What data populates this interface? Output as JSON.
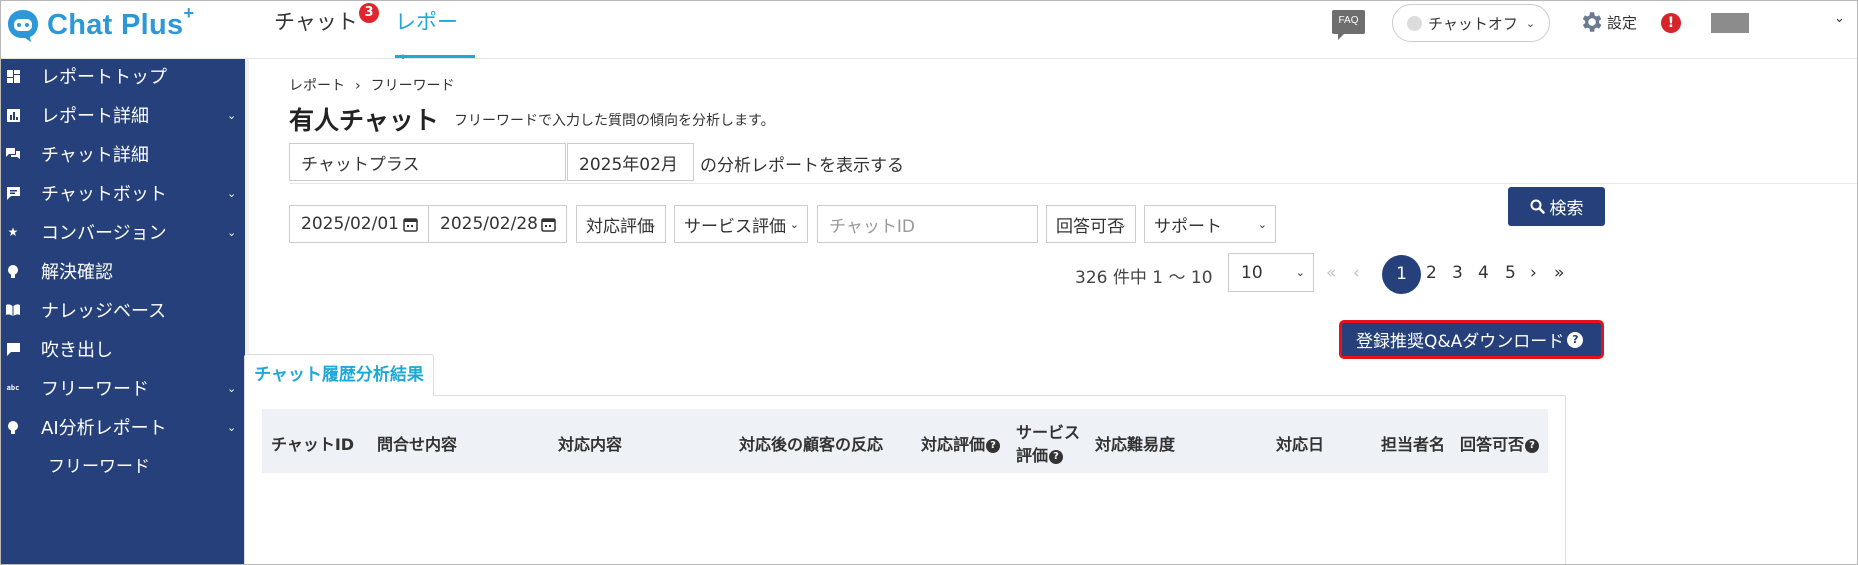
{
  "header": {
    "logo_text": "Chat Plus",
    "logo_plus": "+",
    "tabs": [
      {
        "label": "チャット",
        "badge": "3"
      },
      {
        "label": "レポート"
      }
    ],
    "faq_label": "FAQ",
    "status_label": "チャットオフ",
    "settings_label": "設定",
    "alert_label": "!"
  },
  "sidebar": {
    "items": [
      {
        "label": "レポートトップ"
      },
      {
        "label": "レポート詳細"
      },
      {
        "label": "チャット詳細"
      },
      {
        "label": "チャットボット"
      },
      {
        "label": "コンバージョン"
      },
      {
        "label": "解決確認"
      },
      {
        "label": "ナレッジベース"
      },
      {
        "label": "吹き出し"
      },
      {
        "label": "フリーワード"
      },
      {
        "label": "AI分析レポート"
      }
    ],
    "sub_item": "フリーワード"
  },
  "main": {
    "breadcrumb": [
      "レポート",
      "フリーワード"
    ],
    "breadcrumb_sep": "›",
    "title": "有人チャット",
    "description": "フリーワードで入力した質問の傾向を分析します。",
    "site_value": "チャットプラス",
    "month_value": "2025年02月",
    "month_suffix": "の分析レポートを表示する",
    "filters": {
      "date_from": "2025/02/01",
      "date_to": "2025/02/28",
      "response_rating": "対応評価",
      "service_rating": "サービス評価",
      "chat_id_placeholder": "チャットID",
      "answerable": "回答可否",
      "support": "サポート",
      "search_label": "検索"
    },
    "pagination": {
      "info": "326 件中 1 〜 10",
      "per_page": "10",
      "first": "«",
      "prev": "‹",
      "pages": [
        "1",
        "2",
        "3",
        "4",
        "5"
      ],
      "next": "›",
      "last": "»"
    },
    "download_label": "登録推奨Q&Aダウンロード",
    "help_glyph": "?",
    "result_tab": "チャット履歴分析結果",
    "table_headers": [
      "チャットID",
      "問合せ内容",
      "対応内容",
      "対応後の顧客の反応",
      "対応評価",
      "サービス",
      "評価",
      "対応難易度",
      "対応日",
      "担当者名",
      "回答可否"
    ]
  },
  "colors": {
    "sidebar": "#25407a",
    "accent": "#20a8d8",
    "badge": "#e0252f",
    "highlight_border": "#e3131b"
  }
}
